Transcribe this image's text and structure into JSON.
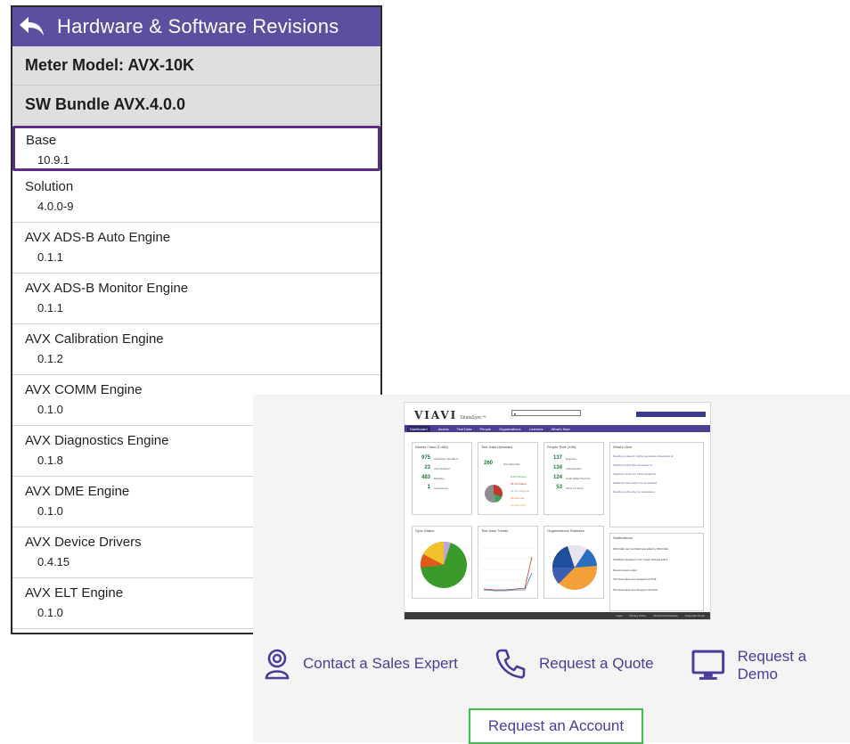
{
  "device": {
    "title": "Hardware & Software Revisions",
    "meter_model": "Meter Model: AVX-10K",
    "sw_bundle": "SW Bundle AVX.4.0.0",
    "items": [
      {
        "name": "Base",
        "version": "10.9.1",
        "selected": true
      },
      {
        "name": "Solution",
        "version": "4.0.0-9"
      },
      {
        "name": "AVX ADS-B Auto Engine",
        "version": "0.1.1"
      },
      {
        "name": "AVX ADS-B Monitor Engine",
        "version": "0.1.1"
      },
      {
        "name": "AVX Calibration Engine",
        "version": "0.1.2"
      },
      {
        "name": "AVX COMM Engine",
        "version": "0.1.0"
      },
      {
        "name": "AVX Diagnostics Engine",
        "version": "0.1.8"
      },
      {
        "name": "AVX DME Engine",
        "version": "0.1.0"
      },
      {
        "name": "AVX Device Drivers",
        "version": "0.4.15"
      },
      {
        "name": "AVX ELT Engine",
        "version": "0.1.0"
      }
    ],
    "colors": {
      "header": "#5c4fa0",
      "selected_border": "#5a2c82"
    }
  },
  "dashboard": {
    "logo": "VIAVI",
    "product": "StrataSync™",
    "nav": [
      "Dashboard",
      "Assets",
      "Test Data",
      "People",
      "Organizations",
      "Licenses",
      "What's New"
    ],
    "assets_title": "Assets Class (1,484)",
    "assets": [
      {
        "value": "975",
        "label": "StrataSync Enabled"
      },
      {
        "value": "23",
        "label": "User Defined"
      },
      {
        "value": "483",
        "label": "Modules"
      },
      {
        "value": "1",
        "label": "Accessories"
      }
    ],
    "test_title": "Test Data Uploaded",
    "test_value": "260",
    "test_label": "Test Data files",
    "test_stats": [
      "8.5% Passed",
      "28.1% Failed",
      "63.4% Marginal",
      "0% Errored",
      "0% Marginal"
    ],
    "people_title": "People Role (498)",
    "people": [
      {
        "value": "137",
        "label": "Engineer"
      },
      {
        "value": "134",
        "label": "Administrator"
      },
      {
        "value": "124",
        "label": "Unidentified Technol"
      },
      {
        "value": "53",
        "label": "Other (3 roles)"
      }
    ],
    "whatsnew_title": "What's New",
    "sync_title": "Sync Status",
    "trends_title": "Test Data Trends",
    "orgstats_title": "Organizations Statistics",
    "notifications_title": "Notifications",
    "footer": [
      "Legal",
      "Privacy Policy",
      "Technical Assistance",
      "Corporate Home"
    ]
  },
  "cta": {
    "sales": "Contact a Sales Expert",
    "quote": "Request a Quote",
    "demo": "Request a Demo",
    "account": "Request an Account"
  }
}
